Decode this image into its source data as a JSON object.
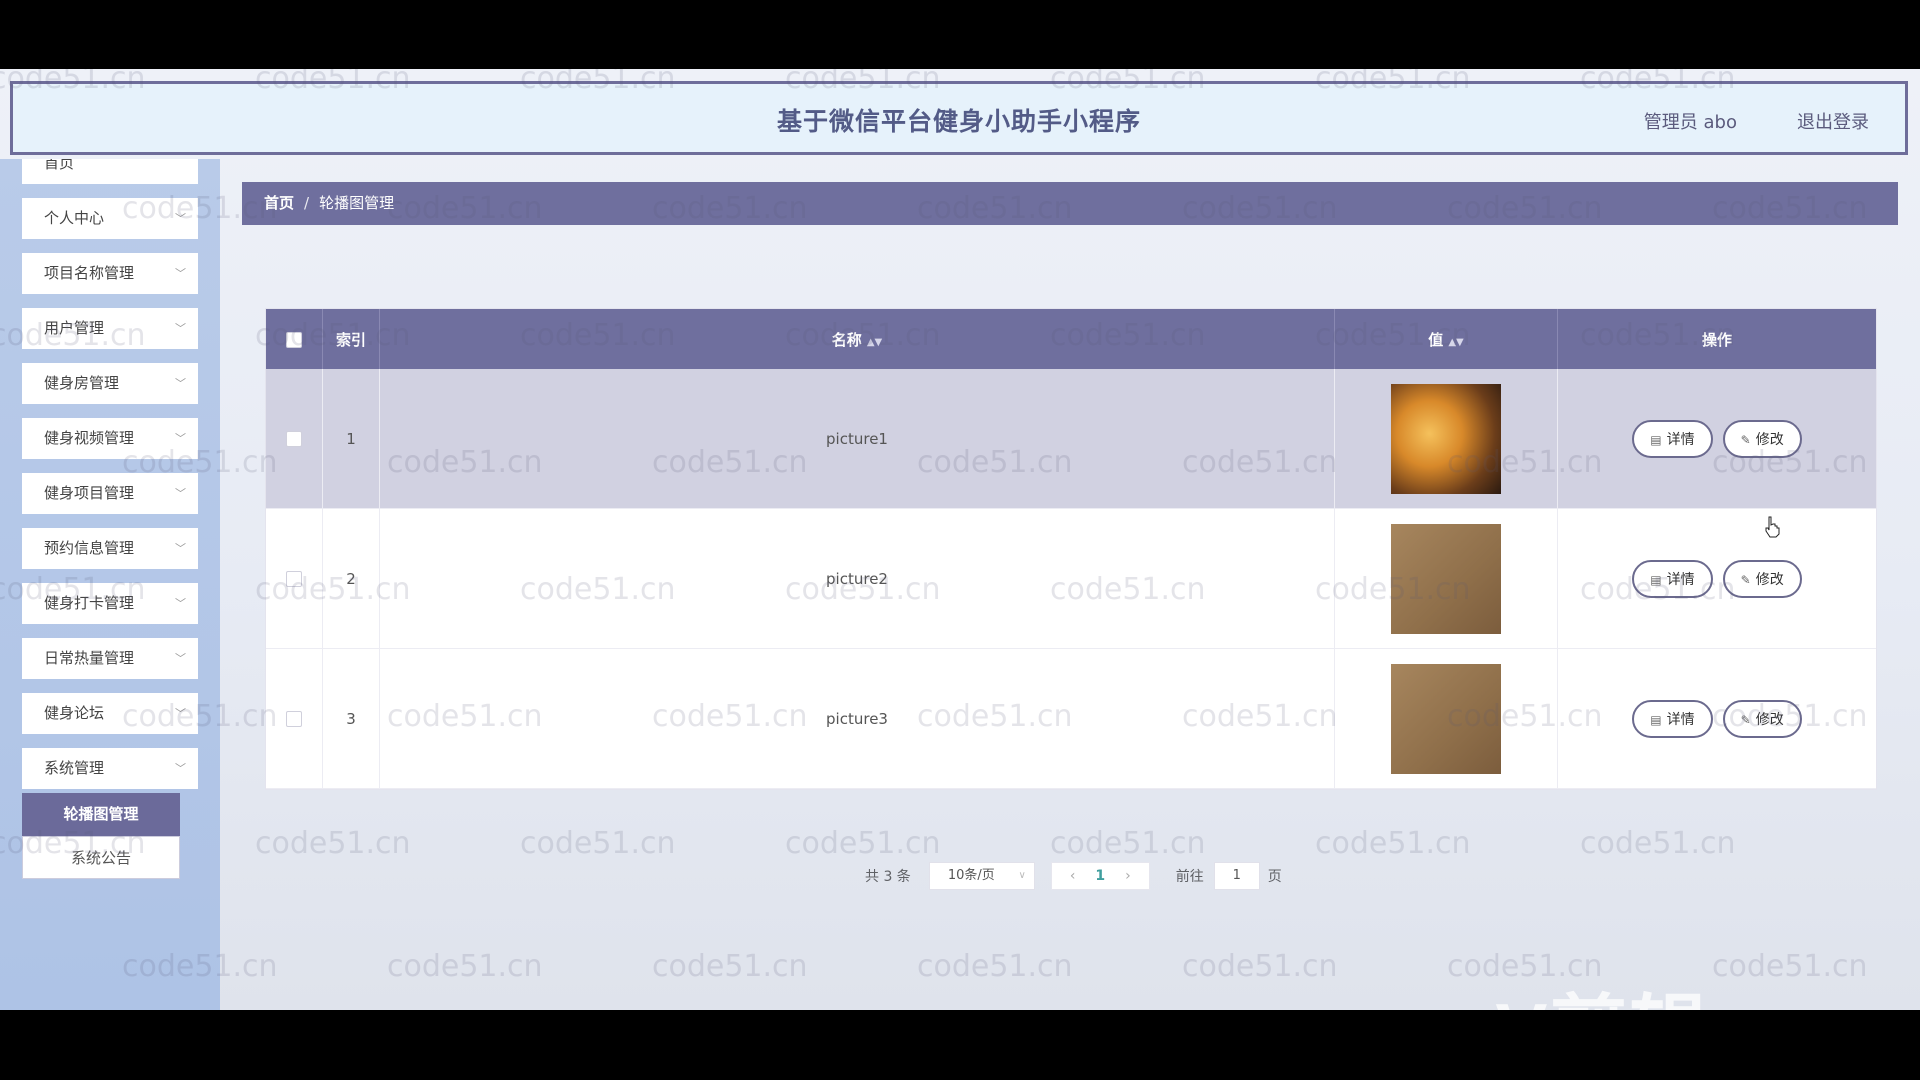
{
  "header": {
    "title": "基于微信平台健身小助手小程序",
    "user": "管理员 abo",
    "logout": "退出登录"
  },
  "sidebar": {
    "items": [
      {
        "label": "首页"
      },
      {
        "label": "个人中心"
      },
      {
        "label": "项目名称管理"
      },
      {
        "label": "用户管理"
      },
      {
        "label": "健身房管理"
      },
      {
        "label": "健身视频管理"
      },
      {
        "label": "健身项目管理"
      },
      {
        "label": "预约信息管理"
      },
      {
        "label": "健身打卡管理"
      },
      {
        "label": "日常热量管理"
      },
      {
        "label": "健身论坛"
      },
      {
        "label": "系统管理"
      }
    ],
    "submenu": [
      {
        "label": "轮播图管理",
        "active": true
      },
      {
        "label": "系统公告",
        "active": false
      }
    ]
  },
  "breadcrumb": {
    "home": "首页",
    "separator": "/",
    "current": "轮播图管理"
  },
  "table": {
    "columns": {
      "index": "索引",
      "name": "名称",
      "value": "值",
      "actions": "操作"
    },
    "rows": [
      {
        "index": "1",
        "name": "picture1",
        "image": "gym-photo",
        "highlighted": true
      },
      {
        "index": "2",
        "name": "picture2",
        "image": "brown-photo",
        "highlighted": false
      },
      {
        "index": "3",
        "name": "picture3",
        "image": "brown-photo",
        "highlighted": false
      }
    ],
    "detail_label": "详情",
    "edit_label": "修改"
  },
  "pagination": {
    "total": "共 3 条",
    "page_size": "10条/页",
    "current_page": "1",
    "goto_label": "前往",
    "goto_value": "1",
    "page_suffix": "页"
  },
  "watermark": {
    "text": "code51.cn",
    "logo": "eV剪辑"
  },
  "colors": {
    "accent": "#6f6f9e",
    "header_bg": "#e6f2fb",
    "sidebar_bg": "#b9cbe9",
    "highlight_row": "#d1d1e1"
  }
}
